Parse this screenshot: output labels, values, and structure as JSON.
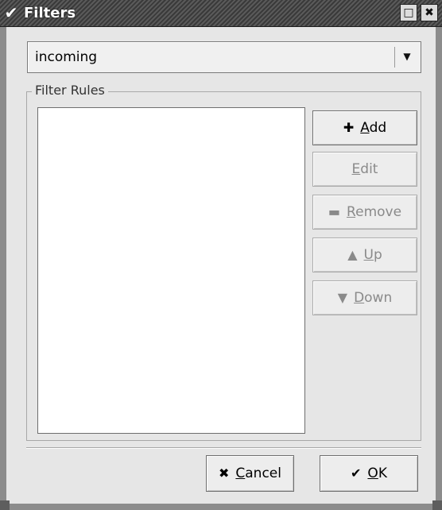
{
  "window": {
    "title": "Filters",
    "menu_icon": "chevron-down-icon",
    "maximize_icon": "maximize-icon",
    "close_icon": "close-icon"
  },
  "combo": {
    "value": "incoming",
    "arrow_icon": "chevron-down-icon"
  },
  "group": {
    "label": "Filter Rules"
  },
  "buttons": {
    "add": {
      "mnemonic": "A",
      "rest": "dd",
      "icon": "plus-icon",
      "enabled": true
    },
    "edit": {
      "mnemonic": "E",
      "rest": "dit",
      "enabled": false
    },
    "remove": {
      "mnemonic": "R",
      "rest": "emove",
      "icon": "minus-icon",
      "enabled": false
    },
    "up": {
      "mnemonic": "U",
      "rest": "p",
      "icon": "up-arrow-icon",
      "enabled": false
    },
    "down": {
      "mnemonic": "D",
      "rest": "own",
      "icon": "down-arrow-icon",
      "enabled": false
    }
  },
  "footer": {
    "cancel": {
      "mnemonic": "C",
      "rest": "ancel",
      "icon": "cancel-icon"
    },
    "ok": {
      "mnemonic": "O",
      "rest": "K",
      "icon": "ok-check-icon"
    }
  }
}
